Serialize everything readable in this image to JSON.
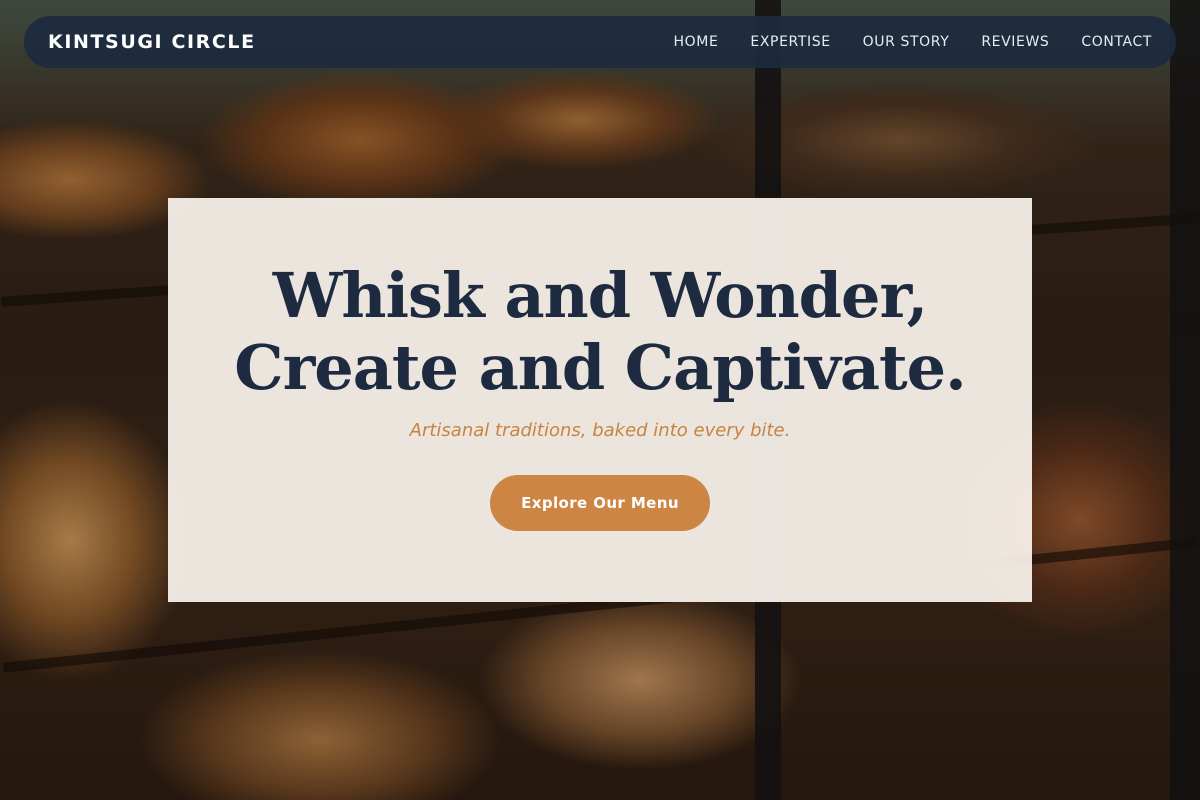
{
  "header": {
    "brand": "KINTSUGI CIRCLE",
    "nav": [
      {
        "label": "HOME"
      },
      {
        "label": "EXPERTISE"
      },
      {
        "label": "OUR STORY"
      },
      {
        "label": "REVIEWS"
      },
      {
        "label": "CONTACT"
      }
    ]
  },
  "hero": {
    "headline_line1": "Whisk and Wonder,",
    "headline_line2": "Create and Captivate.",
    "tagline": "Artisanal traditions, baked into every bite.",
    "cta_label": "Explore Our Menu"
  },
  "colors": {
    "nav_background": "#1d2a3f",
    "headline": "#1d2a40",
    "accent": "#cd8544",
    "card_background": "#fcf6f0"
  }
}
